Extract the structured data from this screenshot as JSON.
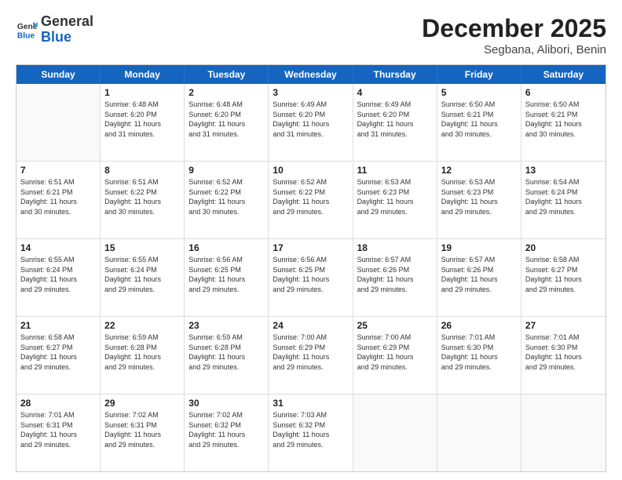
{
  "header": {
    "logo_general": "General",
    "logo_blue": "Blue",
    "month_year": "December 2025",
    "location": "Segbana, Alibori, Benin"
  },
  "days_of_week": [
    "Sunday",
    "Monday",
    "Tuesday",
    "Wednesday",
    "Thursday",
    "Friday",
    "Saturday"
  ],
  "rows": [
    [
      {
        "day": "",
        "info": ""
      },
      {
        "day": "1",
        "info": "Sunrise: 6:48 AM\nSunset: 6:20 PM\nDaylight: 11 hours\nand 31 minutes."
      },
      {
        "day": "2",
        "info": "Sunrise: 6:48 AM\nSunset: 6:20 PM\nDaylight: 11 hours\nand 31 minutes."
      },
      {
        "day": "3",
        "info": "Sunrise: 6:49 AM\nSunset: 6:20 PM\nDaylight: 11 hours\nand 31 minutes."
      },
      {
        "day": "4",
        "info": "Sunrise: 6:49 AM\nSunset: 6:20 PM\nDaylight: 11 hours\nand 31 minutes."
      },
      {
        "day": "5",
        "info": "Sunrise: 6:50 AM\nSunset: 6:21 PM\nDaylight: 11 hours\nand 30 minutes."
      },
      {
        "day": "6",
        "info": "Sunrise: 6:50 AM\nSunset: 6:21 PM\nDaylight: 11 hours\nand 30 minutes."
      }
    ],
    [
      {
        "day": "7",
        "info": "Sunrise: 6:51 AM\nSunset: 6:21 PM\nDaylight: 11 hours\nand 30 minutes."
      },
      {
        "day": "8",
        "info": "Sunrise: 6:51 AM\nSunset: 6:22 PM\nDaylight: 11 hours\nand 30 minutes."
      },
      {
        "day": "9",
        "info": "Sunrise: 6:52 AM\nSunset: 6:22 PM\nDaylight: 11 hours\nand 30 minutes."
      },
      {
        "day": "10",
        "info": "Sunrise: 6:52 AM\nSunset: 6:22 PM\nDaylight: 11 hours\nand 29 minutes."
      },
      {
        "day": "11",
        "info": "Sunrise: 6:53 AM\nSunset: 6:23 PM\nDaylight: 11 hours\nand 29 minutes."
      },
      {
        "day": "12",
        "info": "Sunrise: 6:53 AM\nSunset: 6:23 PM\nDaylight: 11 hours\nand 29 minutes."
      },
      {
        "day": "13",
        "info": "Sunrise: 6:54 AM\nSunset: 6:24 PM\nDaylight: 11 hours\nand 29 minutes."
      }
    ],
    [
      {
        "day": "14",
        "info": "Sunrise: 6:55 AM\nSunset: 6:24 PM\nDaylight: 11 hours\nand 29 minutes."
      },
      {
        "day": "15",
        "info": "Sunrise: 6:55 AM\nSunset: 6:24 PM\nDaylight: 11 hours\nand 29 minutes."
      },
      {
        "day": "16",
        "info": "Sunrise: 6:56 AM\nSunset: 6:25 PM\nDaylight: 11 hours\nand 29 minutes."
      },
      {
        "day": "17",
        "info": "Sunrise: 6:56 AM\nSunset: 6:25 PM\nDaylight: 11 hours\nand 29 minutes."
      },
      {
        "day": "18",
        "info": "Sunrise: 6:57 AM\nSunset: 6:26 PM\nDaylight: 11 hours\nand 29 minutes."
      },
      {
        "day": "19",
        "info": "Sunrise: 6:57 AM\nSunset: 6:26 PM\nDaylight: 11 hours\nand 29 minutes."
      },
      {
        "day": "20",
        "info": "Sunrise: 6:58 AM\nSunset: 6:27 PM\nDaylight: 11 hours\nand 29 minutes."
      }
    ],
    [
      {
        "day": "21",
        "info": "Sunrise: 6:58 AM\nSunset: 6:27 PM\nDaylight: 11 hours\nand 29 minutes."
      },
      {
        "day": "22",
        "info": "Sunrise: 6:59 AM\nSunset: 6:28 PM\nDaylight: 11 hours\nand 29 minutes."
      },
      {
        "day": "23",
        "info": "Sunrise: 6:59 AM\nSunset: 6:28 PM\nDaylight: 11 hours\nand 29 minutes."
      },
      {
        "day": "24",
        "info": "Sunrise: 7:00 AM\nSunset: 6:29 PM\nDaylight: 11 hours\nand 29 minutes."
      },
      {
        "day": "25",
        "info": "Sunrise: 7:00 AM\nSunset: 6:29 PM\nDaylight: 11 hours\nand 29 minutes."
      },
      {
        "day": "26",
        "info": "Sunrise: 7:01 AM\nSunset: 6:30 PM\nDaylight: 11 hours\nand 29 minutes."
      },
      {
        "day": "27",
        "info": "Sunrise: 7:01 AM\nSunset: 6:30 PM\nDaylight: 11 hours\nand 29 minutes."
      }
    ],
    [
      {
        "day": "28",
        "info": "Sunrise: 7:01 AM\nSunset: 6:31 PM\nDaylight: 11 hours\nand 29 minutes."
      },
      {
        "day": "29",
        "info": "Sunrise: 7:02 AM\nSunset: 6:31 PM\nDaylight: 11 hours\nand 29 minutes."
      },
      {
        "day": "30",
        "info": "Sunrise: 7:02 AM\nSunset: 6:32 PM\nDaylight: 11 hours\nand 29 minutes."
      },
      {
        "day": "31",
        "info": "Sunrise: 7:03 AM\nSunset: 6:32 PM\nDaylight: 11 hours\nand 29 minutes."
      },
      {
        "day": "",
        "info": ""
      },
      {
        "day": "",
        "info": ""
      },
      {
        "day": "",
        "info": ""
      }
    ]
  ]
}
